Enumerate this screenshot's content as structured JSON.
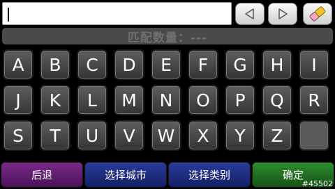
{
  "search": {
    "value": ""
  },
  "toolbar": {
    "back_icon": "triangle-left-icon",
    "forward_icon": "triangle-right-icon",
    "clear_icon": "eraser-icon"
  },
  "status": {
    "match_count_label": "匹配数量：---"
  },
  "keyboard": {
    "row1": [
      "A",
      "B",
      "C",
      "D",
      "E",
      "F",
      "G",
      "H",
      "I"
    ],
    "row2": [
      "J",
      "K",
      "L",
      "M",
      "N",
      "O",
      "P",
      "Q",
      "R"
    ],
    "row3": [
      "S",
      "T",
      "U",
      "V",
      "W",
      "X",
      "Y",
      "Z",
      ""
    ]
  },
  "buttons": {
    "back": "后退",
    "select_city": "选择城市",
    "select_category": "选择类别",
    "confirm": "确定"
  },
  "watermark": "#45502",
  "colors": {
    "back_button": "#5e1e70",
    "city_button": "#1e2c80",
    "category_button": "#1e2c80",
    "confirm_button": "#227022"
  }
}
